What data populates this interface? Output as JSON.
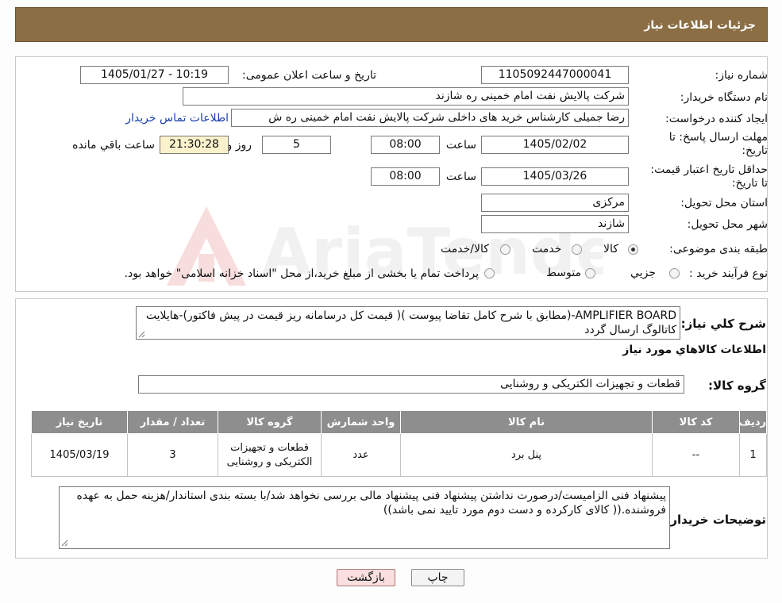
{
  "header": {
    "title": "جزئیات اطلاعات نیاز"
  },
  "form": {
    "need_no_label": "شماره نیاز:",
    "need_no": "1105092447000041",
    "announce_label": "تاریخ و ساعت اعلان عمومی:",
    "announce_value": "1405/01/27 - 10:19",
    "buyer_label": "نام دستگاه خریدار:",
    "buyer_value": "شرکت پالایش نفت امام خمینی  ره  شازند",
    "creator_label": "ایجاد کننده درخواست:",
    "creator_value": "رضا جمیلی کارشناس خرید های داخلی  شرکت پالایش نفت امام خمینی  ره  ش",
    "contact_link": "اطلاعات تماس خریدار",
    "deadline_label": "مهلت ارسال پاسخ: تا تاریخ:",
    "deadline_date": "1405/02/02",
    "time_label": "ساعت",
    "deadline_time": "08:00",
    "days_value": "5",
    "days_label": "روز و",
    "countdown": "21:30:28",
    "remaining_label": "ساعت باقي مانده",
    "validity_label": "حداقل تاریخ اعتبار قیمت: تا تاریخ:",
    "validity_date": "1405/03/26",
    "validity_time": "08:00",
    "province_label": "استان محل تحویل:",
    "province_value": "مرکزی",
    "city_label": "شهر محل تحویل:",
    "city_value": "شازند",
    "category_label": "طبقه بندی موضوعی:",
    "category_options": [
      "کالا",
      "خدمت",
      "کالا/خدمت"
    ],
    "process_label": "نوع فرآیند خرید :",
    "process_options": [
      "جزیي",
      "متوسط"
    ],
    "process_note": "پرداخت تمام یا بخشی از مبلغ خرید،از محل \"اسناد خزانه اسلامی\" خواهد بود."
  },
  "details": {
    "summary_label": "شرح کلي نياز:",
    "summary_text": "AMPLIFIER BOARD-(مطابق با شرح کامل تقاضا پیوست )( قیمت کل درسامانه ریز قیمت در پیش فاکتور)-هایلایت کاتالوگ  ارسال گردد",
    "goods_info_title": "اطلاعات کالاهاي مورد نياز",
    "group_label": "گروه کالا:",
    "group_value": "قطعات و تجهیزات الکتریکی و روشنایی"
  },
  "table": {
    "headers": [
      "ردیف",
      "کد کالا",
      "نام کالا",
      "واحد شمارش",
      "گروه کالا",
      "تعداد / مقدار",
      "تاریخ نیاز"
    ],
    "rows": [
      [
        "1",
        "--",
        "پنل برد",
        "عدد",
        "قطعات و تجهیزات الکتریکی و روشنایی",
        "3",
        "1405/03/19"
      ]
    ]
  },
  "notes": {
    "label": "توضیحات خریدار:",
    "text": "پیشنهاد فنی الزامیست/درصورت نداشتن پیشنهاد فنی پیشنهاد مالی بررسی نخواهد شد/با بسته بندی استاندار/هزینه حمل به عهده فروشنده.(( کالای کارکرده و دست دوم مورد تایید نمی باشد))"
  },
  "buttons": {
    "print": "چاپ",
    "back": "بازگشت"
  },
  "watermark": {
    "text": "AriaTender.neT"
  },
  "colors": {
    "header_bg": "#8b6e44",
    "table_header_bg": "#8e8e8e",
    "link": "#1a3fae"
  }
}
